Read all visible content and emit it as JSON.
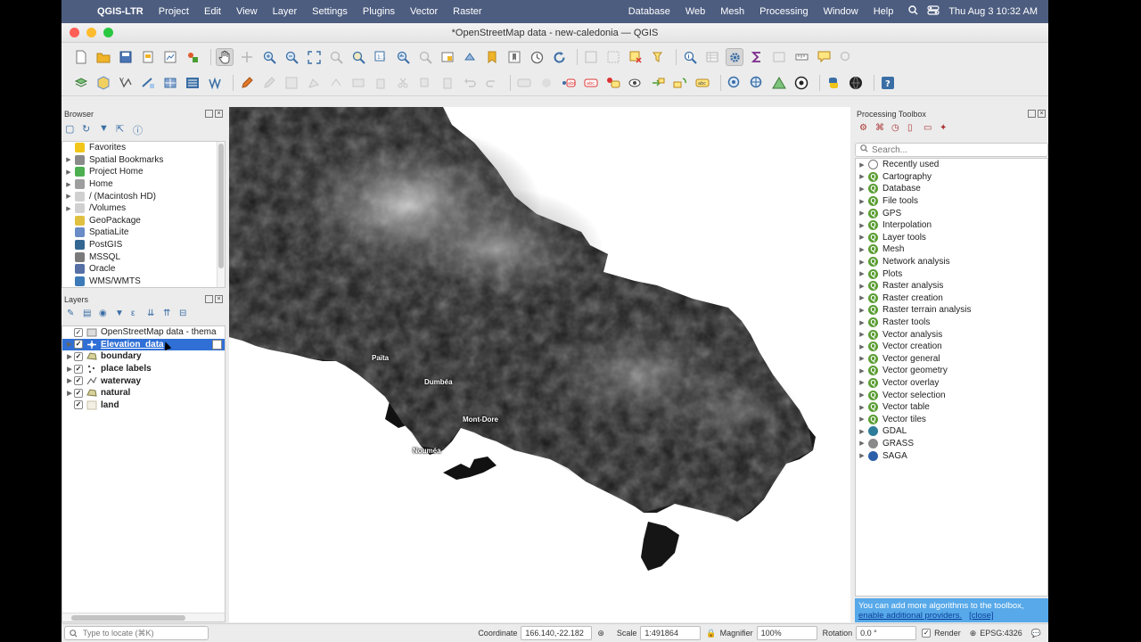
{
  "menubar": {
    "app": "QGIS-LTR",
    "items": [
      "Project",
      "Edit",
      "View",
      "Layer",
      "Settings",
      "Plugins",
      "Vector",
      "Raster",
      "Database",
      "Web",
      "Mesh",
      "Processing",
      "Window",
      "Help"
    ],
    "clock": "Thu Aug 3  10:32 AM",
    "icons": [
      "apple-icon",
      "search-icon",
      "control-center-icon"
    ]
  },
  "window": {
    "title": "*OpenStreetMap data - new-caledonia — QGIS"
  },
  "browser": {
    "title": "Browser",
    "items": [
      {
        "label": "Favorites",
        "icon": "star-icon",
        "color": "#f2c519",
        "expand": false
      },
      {
        "label": "Spatial Bookmarks",
        "icon": "bookmark-icon",
        "color": "#8a8a8a",
        "expand": true
      },
      {
        "label": "Project Home",
        "icon": "project-home-icon",
        "color": "#4caf50",
        "expand": true
      },
      {
        "label": "Home",
        "icon": "home-icon",
        "color": "#9e9e9e",
        "expand": true
      },
      {
        "label": "/ (Macintosh HD)",
        "icon": "folder-icon",
        "color": "#d0d0d0",
        "expand": true
      },
      {
        "label": "/Volumes",
        "icon": "folder-icon",
        "color": "#d0d0d0",
        "expand": true
      },
      {
        "label": "GeoPackage",
        "icon": "geopackage-icon",
        "color": "#e0c040",
        "expand": false
      },
      {
        "label": "SpatiaLite",
        "icon": "spatialite-icon",
        "color": "#6a8cc7",
        "expand": false
      },
      {
        "label": "PostGIS",
        "icon": "postgis-icon",
        "color": "#336791",
        "expand": false
      },
      {
        "label": "MSSQL",
        "icon": "mssql-icon",
        "color": "#7a7a7a",
        "expand": false
      },
      {
        "label": "Oracle",
        "icon": "oracle-icon",
        "color": "#5670a6",
        "expand": false
      },
      {
        "label": "WMS/WMTS",
        "icon": "globe-icon",
        "color": "#3d7ab8",
        "expand": false
      }
    ]
  },
  "layers": {
    "title": "Layers",
    "items": [
      {
        "label": "OpenStreetMap data - thema",
        "icon": "group-icon",
        "checked": true,
        "bold": false,
        "selected": false,
        "expand": false
      },
      {
        "label": "Elevation_data",
        "icon": "raster-icon",
        "checked": true,
        "bold": true,
        "selected": true,
        "expand": true
      },
      {
        "label": "boundary",
        "icon": "polygon-icon",
        "checked": true,
        "bold": true,
        "selected": false,
        "expand": true
      },
      {
        "label": "place labels",
        "icon": "point-icon",
        "checked": true,
        "bold": true,
        "selected": false,
        "expand": true
      },
      {
        "label": "waterway",
        "icon": "line-icon",
        "checked": true,
        "bold": true,
        "selected": false,
        "expand": true
      },
      {
        "label": "natural",
        "icon": "polygon-icon",
        "checked": true,
        "bold": true,
        "selected": false,
        "expand": true
      },
      {
        "label": "land",
        "icon": "fill-icon",
        "checked": true,
        "bold": true,
        "selected": false,
        "expand": false
      }
    ]
  },
  "map": {
    "labels": [
      {
        "text": "Païta"
      },
      {
        "text": "Dumbéa"
      },
      {
        "text": "Mont-Dore"
      },
      {
        "text": "Nouméa"
      }
    ]
  },
  "toolbox": {
    "title": "Processing Toolbox",
    "search_placeholder": "Search...",
    "items": [
      {
        "label": "Recently used",
        "icon": "clock-icon",
        "color": "#ffffff"
      },
      {
        "label": "Cartography",
        "icon": "qgis-icon",
        "color": "#5a9d32"
      },
      {
        "label": "Database",
        "icon": "qgis-icon",
        "color": "#5a9d32"
      },
      {
        "label": "File tools",
        "icon": "qgis-icon",
        "color": "#5a9d32"
      },
      {
        "label": "GPS",
        "icon": "qgis-icon",
        "color": "#5a9d32"
      },
      {
        "label": "Interpolation",
        "icon": "qgis-icon",
        "color": "#5a9d32"
      },
      {
        "label": "Layer tools",
        "icon": "qgis-icon",
        "color": "#5a9d32"
      },
      {
        "label": "Mesh",
        "icon": "qgis-icon",
        "color": "#5a9d32"
      },
      {
        "label": "Network analysis",
        "icon": "qgis-icon",
        "color": "#5a9d32"
      },
      {
        "label": "Plots",
        "icon": "qgis-icon",
        "color": "#5a9d32"
      },
      {
        "label": "Raster analysis",
        "icon": "qgis-icon",
        "color": "#5a9d32"
      },
      {
        "label": "Raster creation",
        "icon": "qgis-icon",
        "color": "#5a9d32"
      },
      {
        "label": "Raster terrain analysis",
        "icon": "qgis-icon",
        "color": "#5a9d32"
      },
      {
        "label": "Raster tools",
        "icon": "qgis-icon",
        "color": "#5a9d32"
      },
      {
        "label": "Vector analysis",
        "icon": "qgis-icon",
        "color": "#5a9d32"
      },
      {
        "label": "Vector creation",
        "icon": "qgis-icon",
        "color": "#5a9d32"
      },
      {
        "label": "Vector general",
        "icon": "qgis-icon",
        "color": "#5a9d32"
      },
      {
        "label": "Vector geometry",
        "icon": "qgis-icon",
        "color": "#5a9d32"
      },
      {
        "label": "Vector overlay",
        "icon": "qgis-icon",
        "color": "#5a9d32"
      },
      {
        "label": "Vector selection",
        "icon": "qgis-icon",
        "color": "#5a9d32"
      },
      {
        "label": "Vector table",
        "icon": "qgis-icon",
        "color": "#5a9d32"
      },
      {
        "label": "Vector tiles",
        "icon": "qgis-icon",
        "color": "#5a9d32"
      },
      {
        "label": "GDAL",
        "icon": "gdal-icon",
        "color": "#2d7d9a"
      },
      {
        "label": "GRASS",
        "icon": "grass-icon",
        "color": "#8a8a8a"
      },
      {
        "label": "SAGA",
        "icon": "saga-icon",
        "color": "#2b5fa8"
      }
    ],
    "notice_text": "You can add more algorithms to the toolbox,",
    "notice_link": "enable additional providers.",
    "notice_close": "[close]"
  },
  "statusbar": {
    "locate_placeholder": "Type to locate (⌘K)",
    "coordinate_label": "Coordinate",
    "coordinate_value": "166.140,-22.182",
    "scale_label": "Scale",
    "scale_value": "1:491864",
    "magnifier_label": "Magnifier",
    "magnifier_value": "100%",
    "rotation_label": "Rotation",
    "rotation_value": "0.0 °",
    "render_label": "Render",
    "crs_label": "EPSG:4326"
  },
  "colors": {
    "menubar": "#4d5d80",
    "selection": "#2f6fd6",
    "notice": "#57a9e9"
  }
}
